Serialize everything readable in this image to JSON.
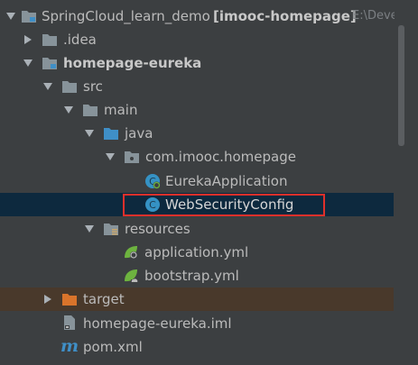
{
  "project_tree": {
    "root": {
      "name": "SpringCloud_learn_demo",
      "module": "[imooc-homepage]",
      "path": "E:\\Develo"
    },
    "items": [
      {
        "label": ".idea",
        "icon": "folder-icon"
      },
      {
        "label": "homepage-eureka",
        "icon": "module-folder-icon"
      },
      {
        "label": "src",
        "icon": "folder-icon"
      },
      {
        "label": "main",
        "icon": "folder-icon"
      },
      {
        "label": "java",
        "icon": "source-folder-icon"
      },
      {
        "label": "com.imooc.homepage",
        "icon": "package-icon"
      },
      {
        "label": "EurekaApplication",
        "icon": "spring-boot-class-icon"
      },
      {
        "label": "WebSecurityConfig",
        "icon": "class-icon"
      },
      {
        "label": "resources",
        "icon": "resources-folder-icon"
      },
      {
        "label": "application.yml",
        "icon": "spring-yml-icon"
      },
      {
        "label": "bootstrap.yml",
        "icon": "spring-yml-icon"
      },
      {
        "label": "target",
        "icon": "excluded-folder-icon"
      },
      {
        "label": "homepage-eureka.iml",
        "icon": "iml-file-icon"
      },
      {
        "label": "pom.xml",
        "icon": "maven-icon"
      }
    ],
    "selected_item": "WebSecurityConfig"
  },
  "colors": {
    "background": "#3c3f41",
    "selection": "#0d293e",
    "excluded_row": "#49392b",
    "highlight_border": "#e0302b",
    "folder": "#87939a",
    "source_folder": "#3f8fc7",
    "excluded_folder": "#d9742b",
    "class_icon": "#3592c4",
    "spring_green": "#6db33f"
  }
}
